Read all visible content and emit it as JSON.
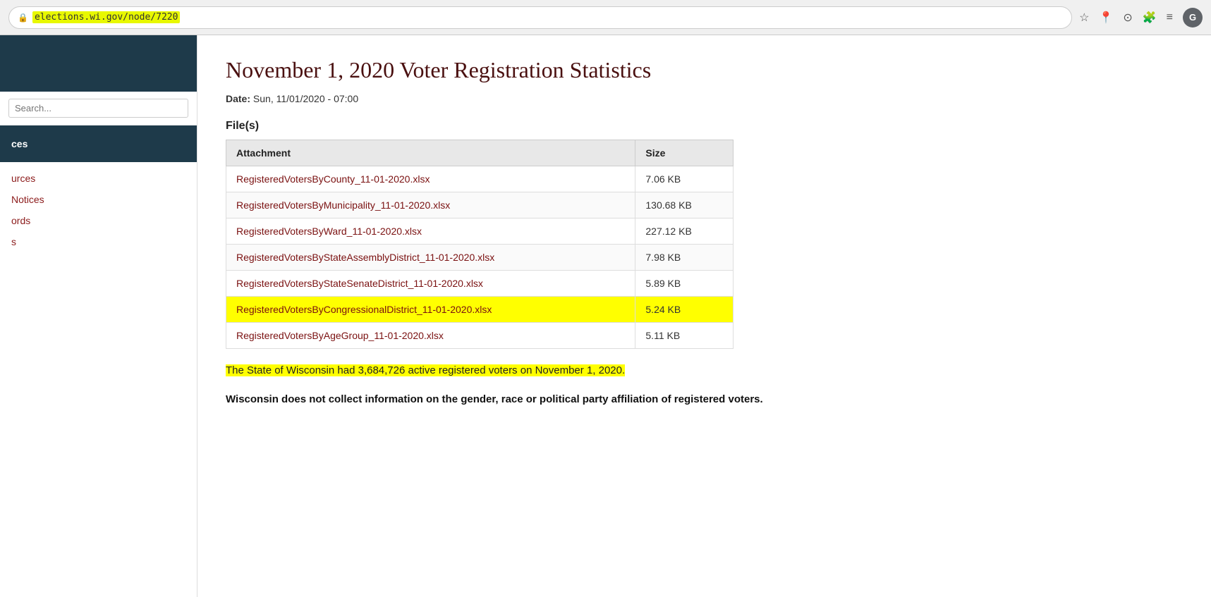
{
  "browser": {
    "url": "elections.wi.gov/node/7220",
    "avatar_label": "G"
  },
  "sidebar": {
    "search_placeholder": "Search...",
    "nav_label": "ces",
    "items": [
      {
        "label": "urces"
      },
      {
        "label": "Notices"
      },
      {
        "label": "ords"
      },
      {
        "label": "s"
      }
    ]
  },
  "page": {
    "title": "November 1, 2020 Voter Registration Statistics",
    "date_label": "Date:",
    "date_value": "Sun, 11/01/2020 - 07:00",
    "files_heading": "File(s)",
    "table": {
      "col_attachment": "Attachment",
      "col_size": "Size",
      "rows": [
        {
          "filename": "RegisteredVotersByCounty_11-01-2020.xlsx",
          "size": "7.06 KB",
          "highlight": false
        },
        {
          "filename": "RegisteredVotersByMunicipality_11-01-2020.xlsx",
          "size": "130.68 KB",
          "highlight": false
        },
        {
          "filename": "RegisteredVotersByWard_11-01-2020.xlsx",
          "size": "227.12 KB",
          "highlight": false
        },
        {
          "filename": "RegisteredVotersByStateAssemblyDistrict_11-01-2020.xlsx",
          "size": "7.98 KB",
          "highlight": false
        },
        {
          "filename": "RegisteredVotersByStateSenateDistrict_11-01-2020.xlsx",
          "size": "5.89 KB",
          "highlight": false
        },
        {
          "filename": "RegisteredVotersByCongressionalDistrict_11-01-2020.xlsx",
          "size": "5.24 KB",
          "highlight": true
        },
        {
          "filename": "RegisteredVotersByAgeGroup_11-01-2020.xlsx",
          "size": "5.11 KB",
          "highlight": false
        }
      ]
    },
    "summary": "The State of Wisconsin had 3,684,726 active registered voters on November 1, 2020.",
    "bold_statement": "Wisconsin does not collect information on the gender, race or political party affiliation of registered voters."
  }
}
